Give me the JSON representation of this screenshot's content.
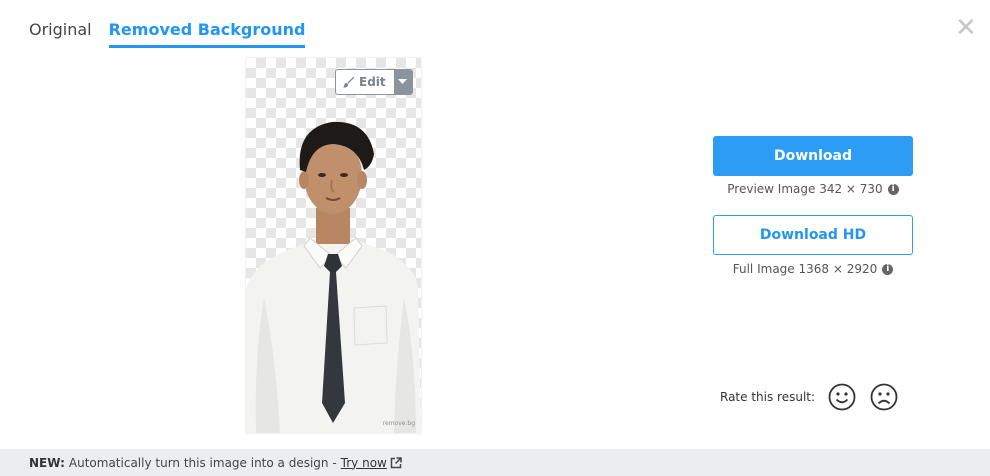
{
  "tabs": [
    {
      "label": "Original",
      "active": false
    },
    {
      "label": "Removed Background",
      "active": true
    }
  ],
  "close_icon": "close-icon",
  "edit": {
    "label": "Edit",
    "icon": "brush-icon",
    "caret_icon": "caret-down-icon"
  },
  "preview": {
    "watermark": "remove.bg"
  },
  "download": {
    "label": "Download",
    "info": "Preview Image 342 × 730",
    "info_icon": "info-icon"
  },
  "download_hd": {
    "label": "Download HD",
    "info": "Full Image 1368 × 2920",
    "info_icon": "info-icon"
  },
  "rating": {
    "label": "Rate this result:",
    "good_icon": "smiley-face-icon",
    "bad_icon": "frowning-face-icon"
  },
  "footer": {
    "new_label": "NEW:",
    "text": "Automatically turn this image into a design -",
    "link_label": "Try now",
    "link_icon": "external-link-icon"
  },
  "colors": {
    "accent": "#2d9cf5",
    "footer_bg": "#ebeef0",
    "checker": "#e6e6e6"
  }
}
